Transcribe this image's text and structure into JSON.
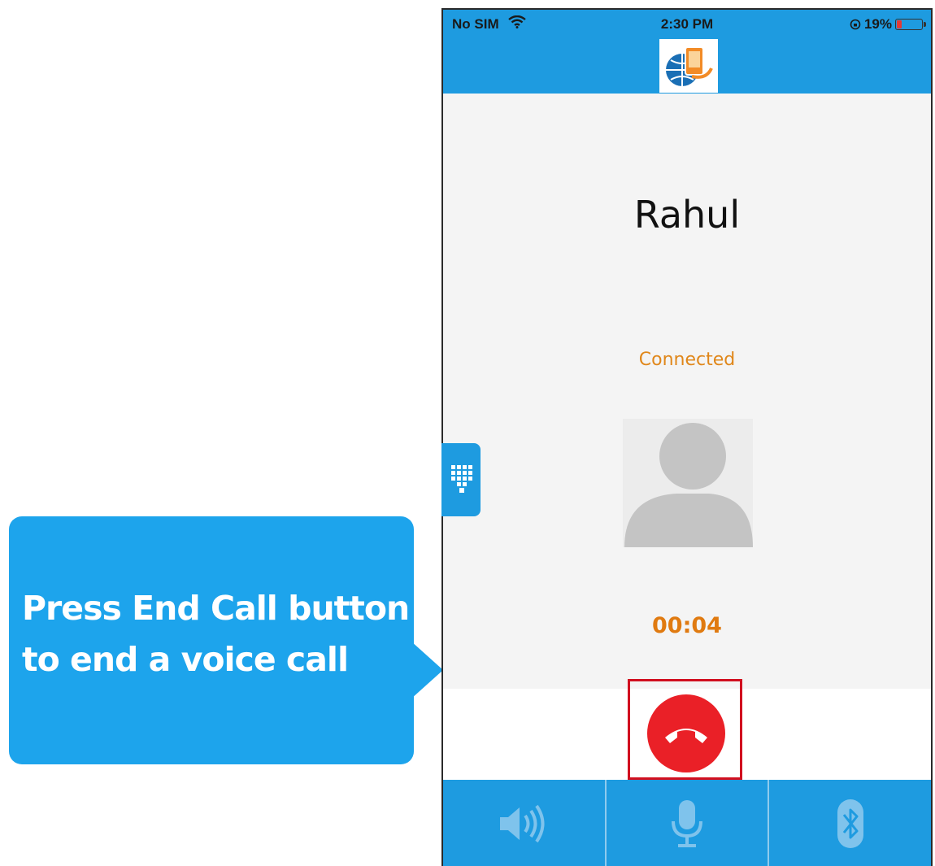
{
  "callout": {
    "line1": "Press End Call button",
    "line2": "to end a voice call",
    "color": "#1da4ec"
  },
  "status_bar": {
    "carrier": "No SIM",
    "time": "2:30 PM",
    "battery": "19%",
    "battery_level": 0.19
  },
  "call": {
    "contact_name": "Rahul",
    "status": "Connected",
    "timer": "00:04",
    "status_color": "#e0871a"
  },
  "controls": {
    "end_call_color": "#ea2027",
    "bar_color": "#1e9be0",
    "icons": [
      "speaker-icon",
      "microphone-icon",
      "bluetooth-icon",
      "dialpad-icon",
      "end-call-icon"
    ]
  }
}
